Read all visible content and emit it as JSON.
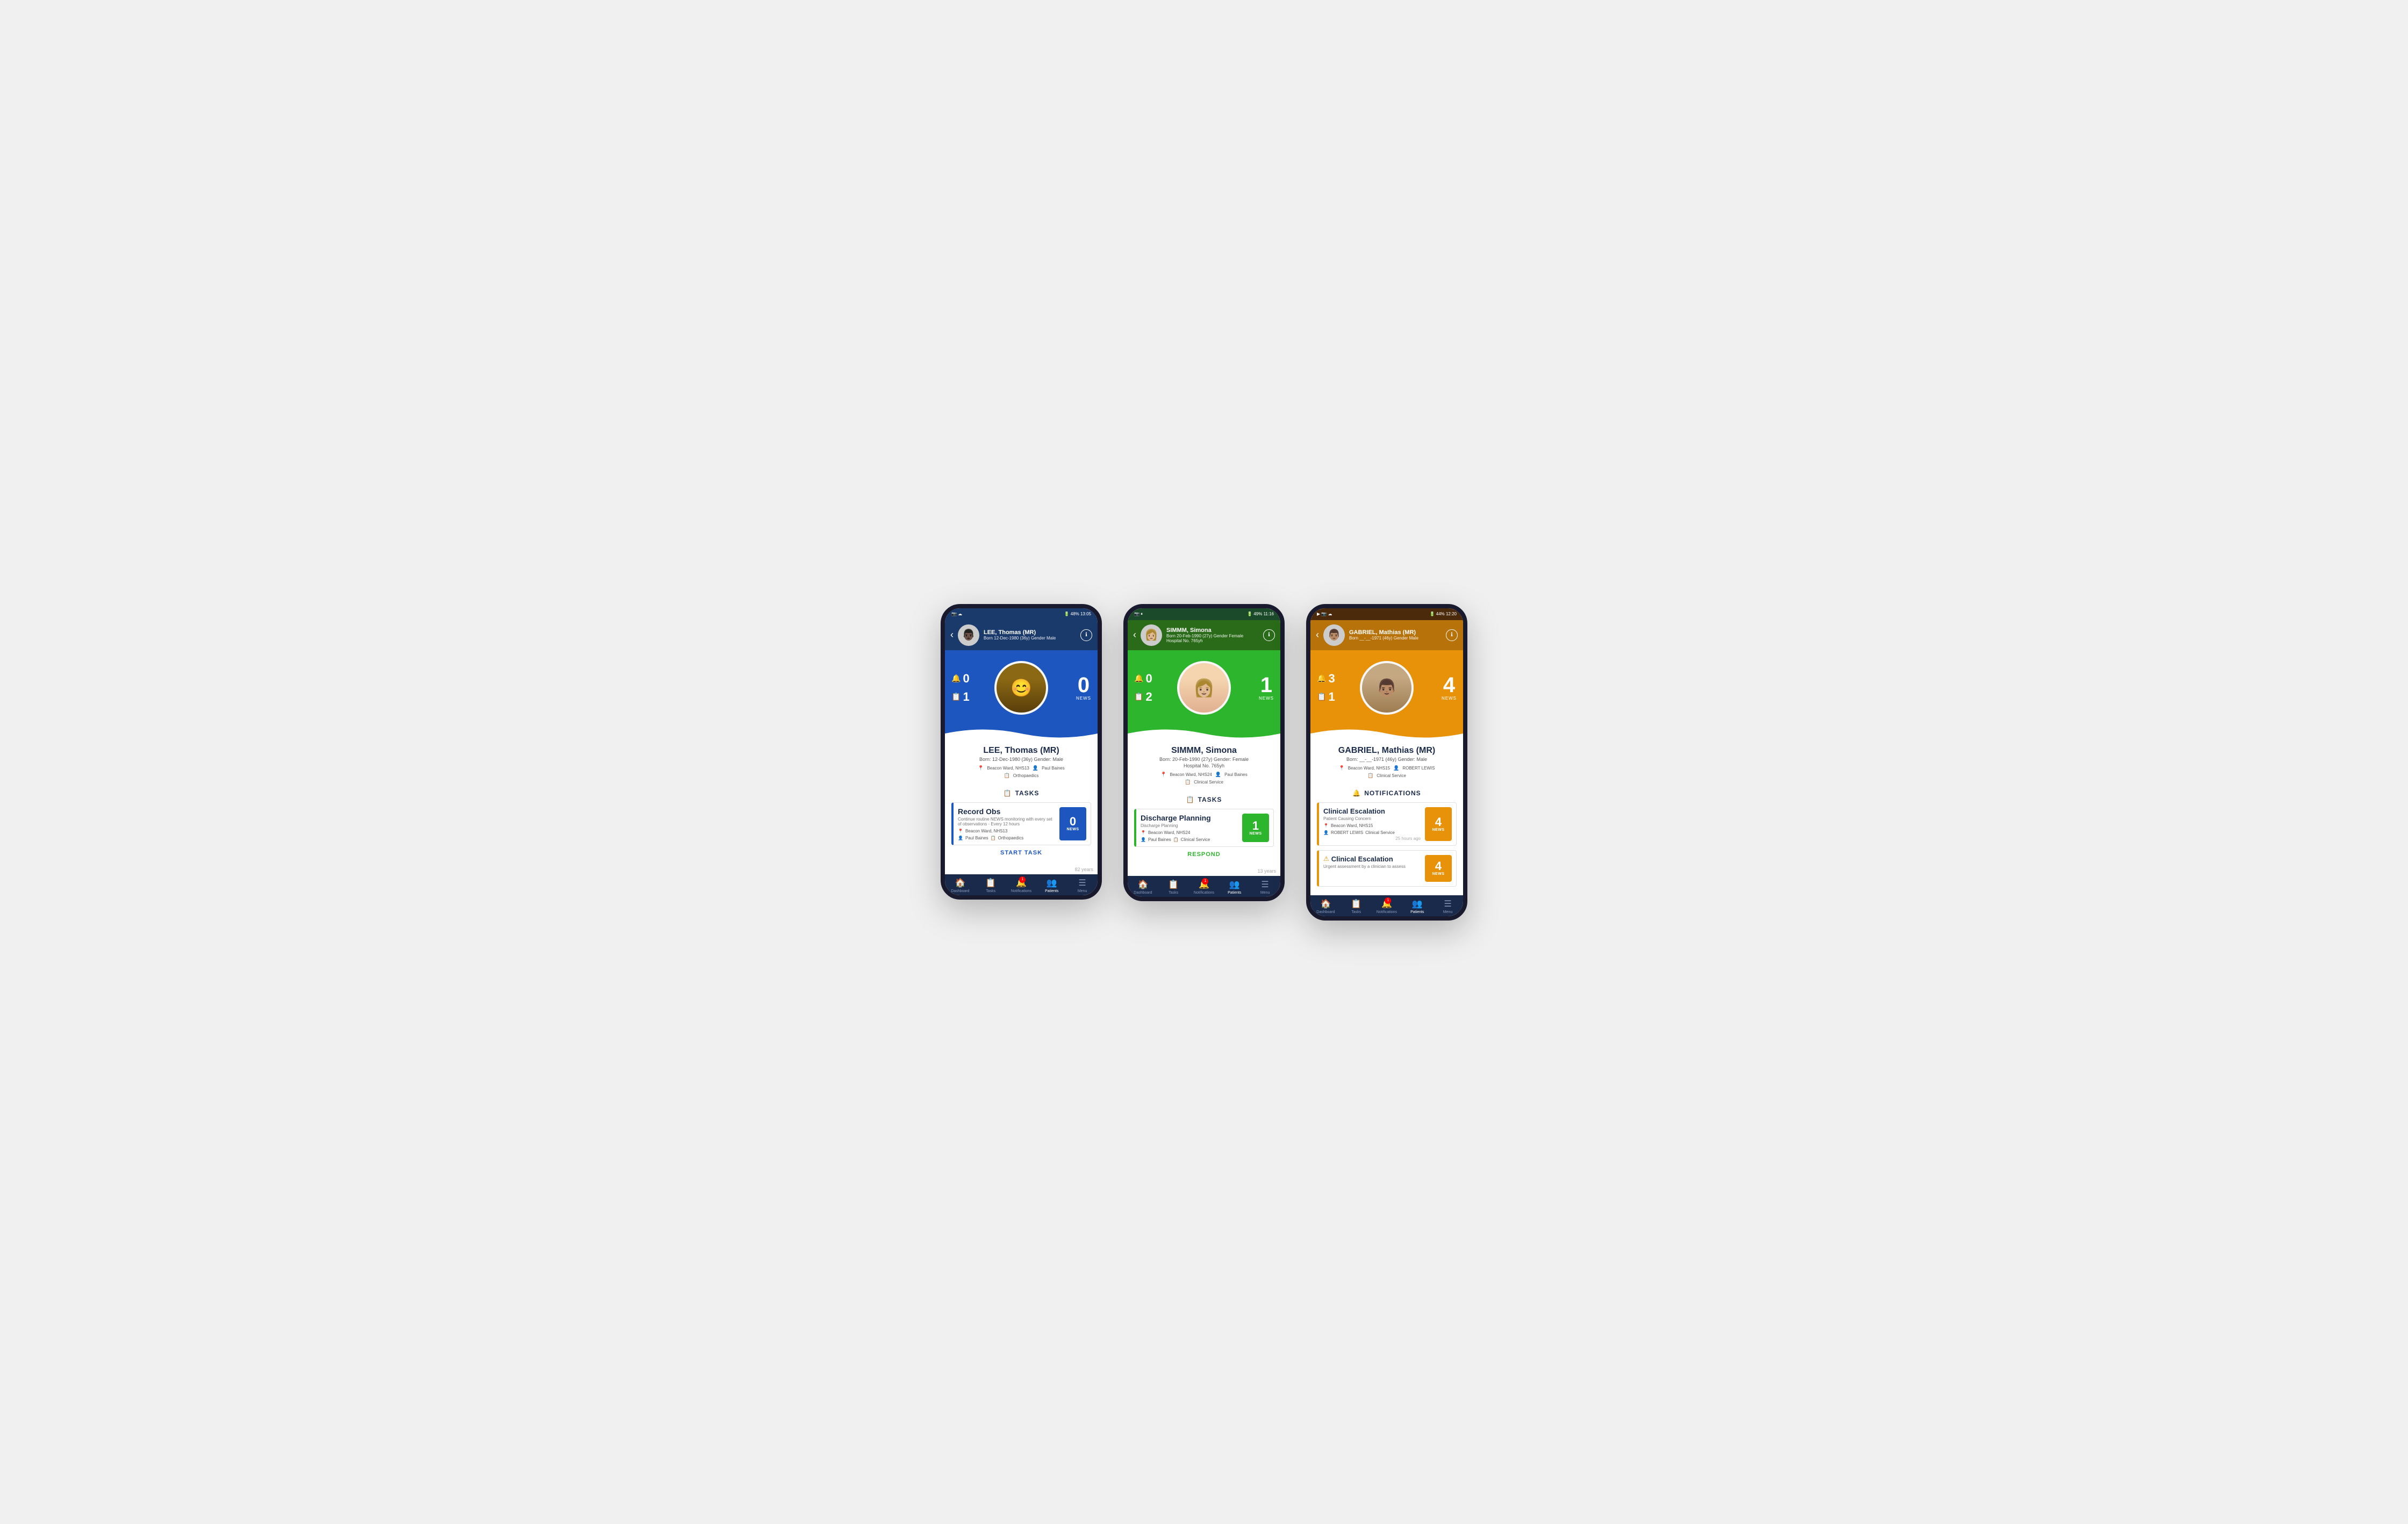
{
  "phones": [
    {
      "id": "phone-1",
      "theme": "blue",
      "status_bar": {
        "left": "📷 ☁",
        "right": "48% 13:05"
      },
      "header": {
        "patient_name": "LEE, Thomas (MR)",
        "born": "Born 12-Dec-1980 (36y)",
        "gender": "Gender Male",
        "hospital_no": null
      },
      "hero": {
        "bell_count": "0",
        "clipboard_count": "1",
        "news_count": "0",
        "news_label": "NEWS"
      },
      "patient_info": {
        "name": "LEE, Thomas (MR)",
        "born_detail": "Born: 12-Dec-1980 (36y) Gender: Male",
        "location": "Beacon Ward, NHS13",
        "doctor": "Paul Baines",
        "specialty": "Orthopaedics"
      },
      "section": "TASKS",
      "tasks": [
        {
          "title": "Record Obs",
          "description": "Continue routine NEWS monitoring with every set of observations - Every 12 hours",
          "location": "Beacon Ward, NHS13",
          "doctor": "Paul Baines",
          "specialty": "Orthopaedics",
          "badge_number": "0",
          "badge_label": "NEWS",
          "action": "START TASK"
        }
      ],
      "age_label": "82 years",
      "nav": {
        "items": [
          "Dashboard",
          "Tasks",
          "Notifications",
          "Patients",
          "Menu"
        ],
        "active": "Patients",
        "badge_on": "Notifications"
      }
    },
    {
      "id": "phone-2",
      "theme": "green",
      "status_bar": {
        "left": "📷 ⏸",
        "right": "49% 11:16"
      },
      "header": {
        "patient_name": "SIMMM, Simona",
        "born": "Born 20-Feb-1990 (27y)",
        "gender": "Gender Female",
        "hospital_no": "Hospital No. 765yh"
      },
      "hero": {
        "bell_count": "0",
        "clipboard_count": "2",
        "news_count": "1",
        "news_label": "NEWS"
      },
      "patient_info": {
        "name": "SIMMM, Simona",
        "born_detail": "Born: 20-Feb-1990 (27y) Gender: Female",
        "hospital_no": "Hospital No. 765yh",
        "location": "Beacon Ward, NHS24",
        "doctor": "Paul Baines",
        "specialty": "Clinical Service"
      },
      "section": "TASKS",
      "tasks": [
        {
          "title": "Discharge Planning",
          "description": "Discharge Planning",
          "location": "Beacon Ward, NHS24",
          "doctor": "Paul Baines",
          "specialty": "Clinical Service",
          "badge_number": "1",
          "badge_label": "NEWS",
          "action": "RESPOND"
        }
      ],
      "age_label": "13 years",
      "nav": {
        "items": [
          "Dashboard",
          "Tasks",
          "Notifications",
          "Patients",
          "Menu"
        ],
        "active": "Patients",
        "badge_on": "Notifications"
      }
    },
    {
      "id": "phone-3",
      "theme": "orange",
      "status_bar": {
        "left": "▶ 📷 ☁",
        "right": "44% 12:20"
      },
      "header": {
        "patient_name": "GABRIEL, Mathias (MR)",
        "born": "Born __-__-1971 (46y)",
        "gender": "Gender Male",
        "hospital_no": null
      },
      "hero": {
        "bell_count": "3",
        "clipboard_count": "1",
        "news_count": "4",
        "news_label": "NEWS"
      },
      "patient_info": {
        "name": "GABRIEL, Mathias (MR)",
        "born_detail": "Born: __-__-1971 (46y) Gender: Male",
        "location": "Beacon Ward, NHS15",
        "doctor": "ROBERT LEWIS",
        "specialty": "Clinical Service"
      },
      "section": "NOTIFICATIONS",
      "notifications": [
        {
          "title": "Clinical Escalation",
          "sub": "Patient Causing Concern",
          "location": "Beacon Ward, NHS15",
          "doctor": "ROBERT LEWIS",
          "specialty": "Clinical Service",
          "badge_number": "4",
          "badge_label": "NEWS",
          "time": "25 hours ago",
          "warning": false
        },
        {
          "title": "Clinical Escalation",
          "sub": "Urgent assessment by a clinician to assess",
          "location": "",
          "doctor": "",
          "specialty": "",
          "badge_number": "4",
          "badge_label": "NEWS",
          "time": "",
          "warning": true
        }
      ],
      "age_label": "",
      "nav": {
        "items": [
          "Dashboard",
          "Tasks",
          "Notifications",
          "Patients",
          "Menu"
        ],
        "active": "Patients",
        "badge_on": "Notifications"
      }
    }
  ]
}
